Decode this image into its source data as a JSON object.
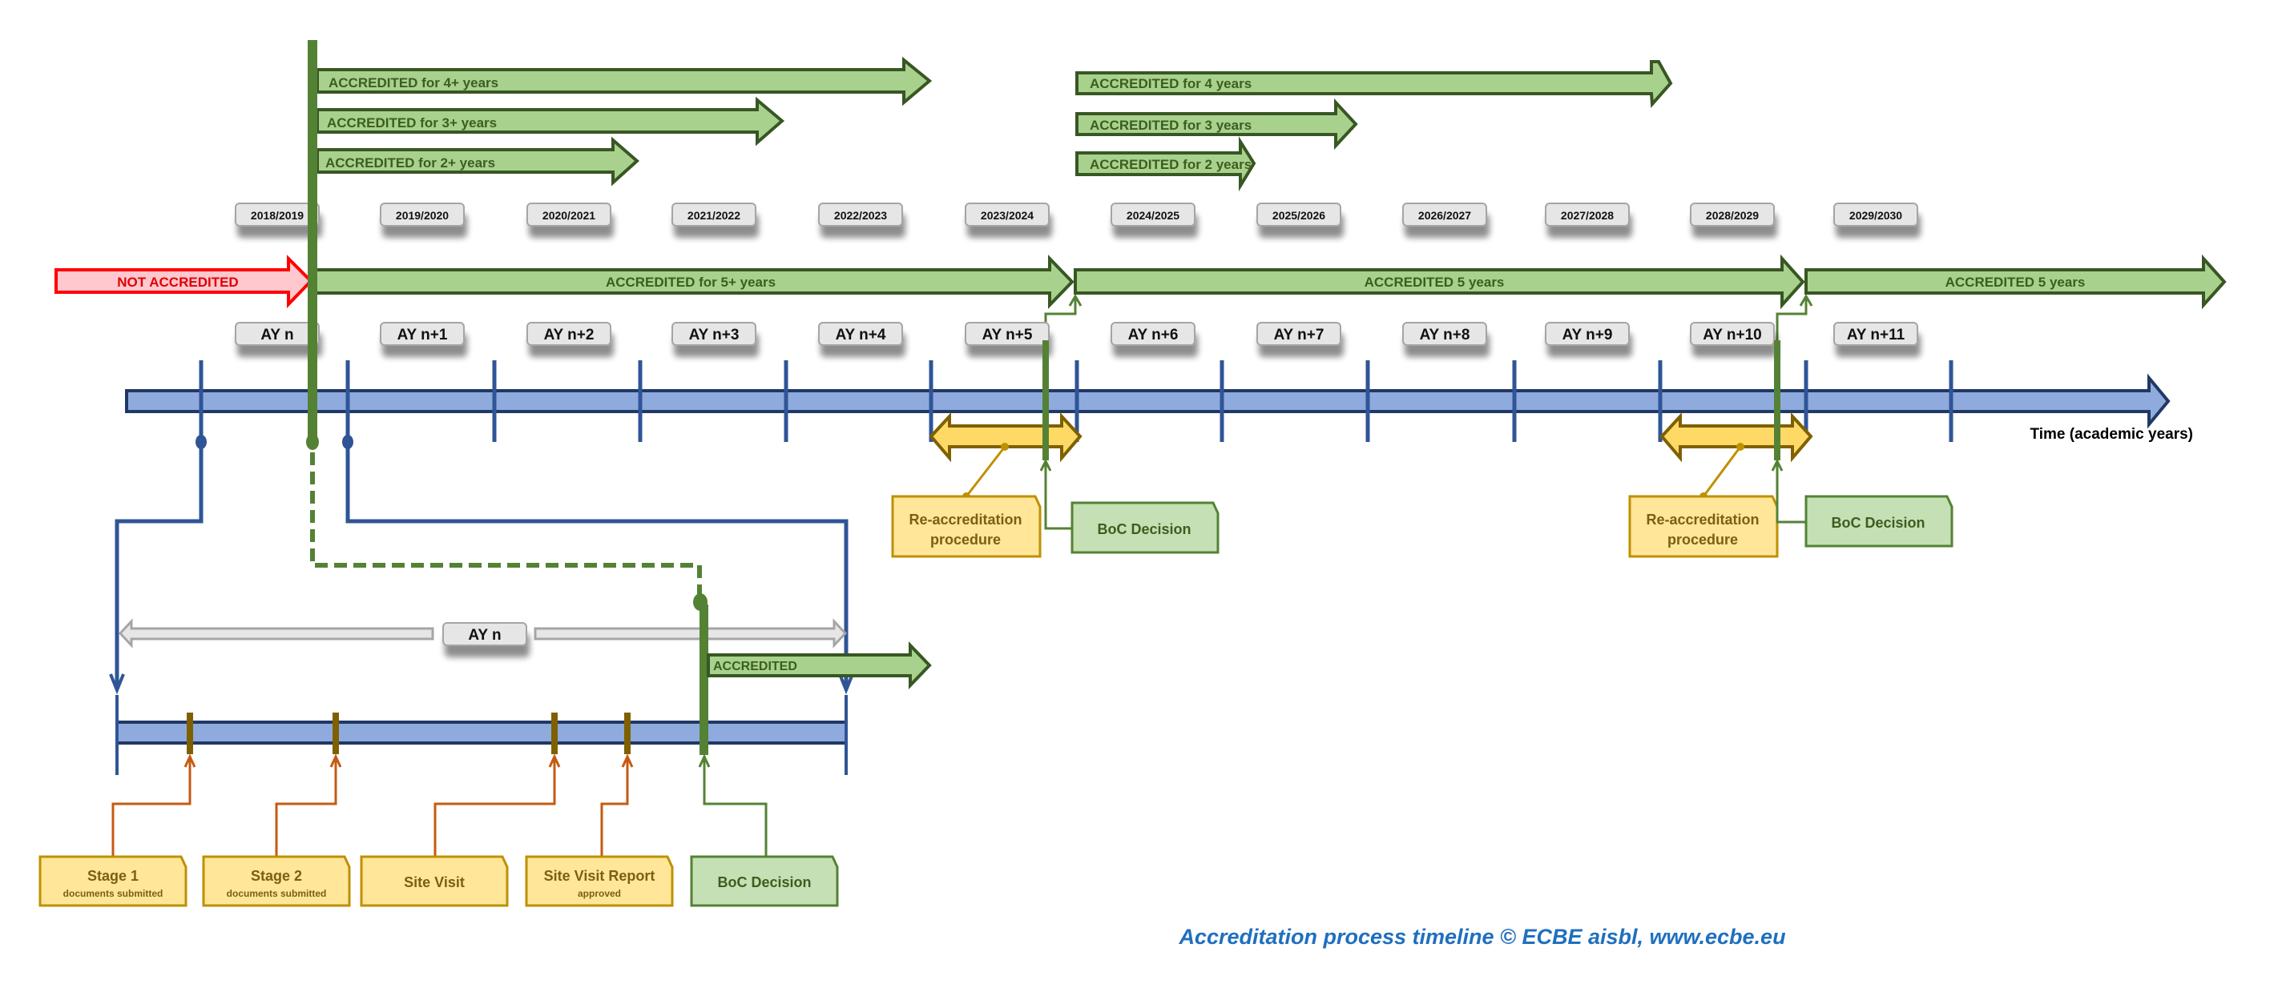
{
  "colors": {
    "accent_green": "#548235",
    "arrow_green_fill": "#a9d18e",
    "arrow_green_stroke": "#385723",
    "timeline_fill": "#8faadc",
    "timeline_stroke": "#203864",
    "tick_blue": "#2f5597",
    "not_accredited_fill": "#ffc7ce",
    "not_accredited_stroke": "#ff0000",
    "procedure_fill": "#ffe699",
    "procedure_stroke": "#bf9000",
    "milestone_orange": "#c55a11",
    "caption_blue": "#1f6fbf"
  },
  "top_left_arrows": [
    {
      "label": "ACCREDITED for 4+ years"
    },
    {
      "label": "ACCREDITED for 3+ years"
    },
    {
      "label": "ACCREDITED for 2+ years"
    }
  ],
  "top_right_arrows": [
    {
      "label": "ACCREDITED for 4 years"
    },
    {
      "label": "ACCREDITED for 3 years"
    },
    {
      "label": "ACCREDITED for 2 years"
    }
  ],
  "academic_years": [
    "2018/2019",
    "2019/2020",
    "2020/2021",
    "2021/2022",
    "2022/2023",
    "2023/2024",
    "2024/2025",
    "2025/2026",
    "2026/2027",
    "2027/2028",
    "2028/2029",
    "2029/2030"
  ],
  "ay_labels": [
    "AY n",
    "AY n+1",
    "AY n+2",
    "AY n+3",
    "AY n+4",
    "AY n+5",
    "AY n+6",
    "AY n+7",
    "AY n+8",
    "AY n+9",
    "AY n+10",
    "AY n+11"
  ],
  "status_arrows": {
    "not_accredited": "NOT ACCREDITED",
    "accredited_first": "ACCREDITED for 5+ years",
    "accredited_second": "ACCREDITED 5 years",
    "accredited_third": "ACCREDITED 5 years"
  },
  "timeline": {
    "axis_label": "Time (academic years)"
  },
  "reaccreditation": [
    {
      "procedure": [
        "Re-accreditation",
        "procedure"
      ],
      "decision": "BoC Decision"
    },
    {
      "procedure": [
        "Re-accreditation",
        "procedure"
      ],
      "decision": "BoC Decision"
    }
  ],
  "detail": {
    "span_label": "AY n",
    "accredited_label": "ACCREDITED",
    "milestones": [
      {
        "title": "Stage 1",
        "subtitle": "documents submitted"
      },
      {
        "title": "Stage 2",
        "subtitle": "documents submitted"
      },
      {
        "title": "Site Visit",
        "subtitle": ""
      },
      {
        "title": "Site Visit Report",
        "subtitle": "approved"
      },
      {
        "title": "BoC Decision",
        "subtitle": ""
      }
    ]
  },
  "caption": "Accreditation process timeline © ECBE aisbl, www.ecbe.eu"
}
